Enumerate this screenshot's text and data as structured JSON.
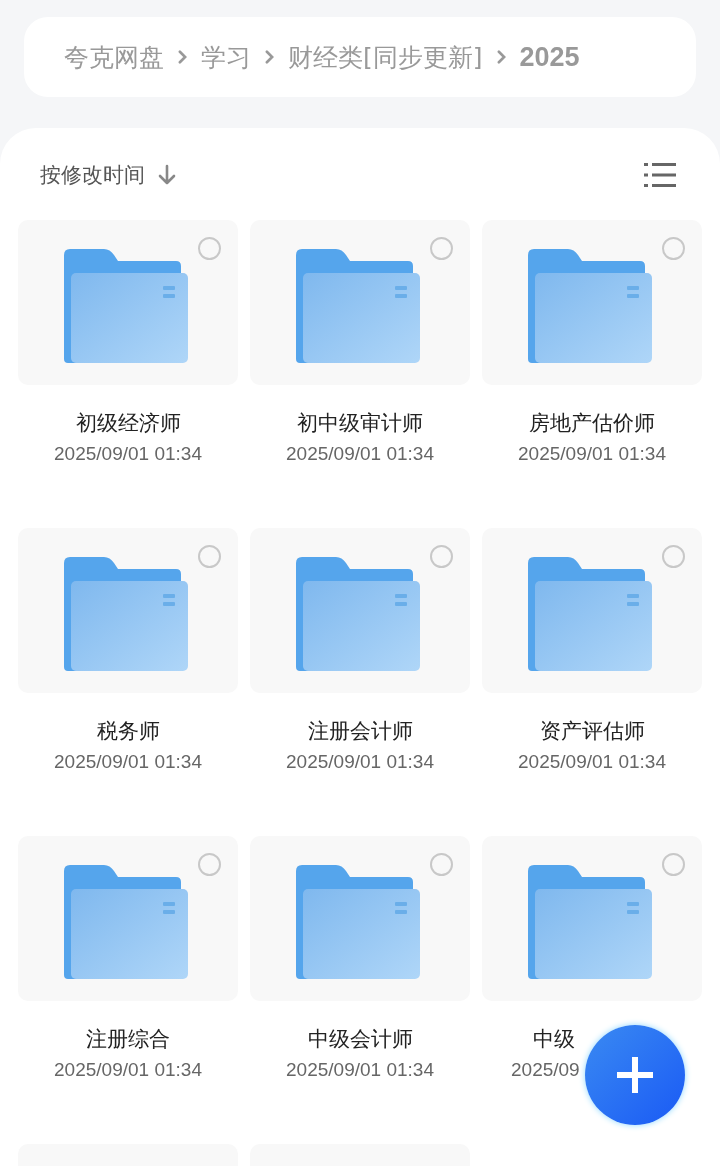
{
  "breadcrumb": [
    "夸克网盘",
    "学习",
    "财经类[同步更新]",
    "2025"
  ],
  "sort": {
    "label": "按修改时间"
  },
  "files": [
    {
      "kind": "folder",
      "name": "初级经济师",
      "date": "2025/09/01 01:34",
      "selected": false
    },
    {
      "kind": "folder",
      "name": "初中级审计师",
      "date": "2025/09/01 01:34",
      "selected": false
    },
    {
      "kind": "folder",
      "name": "房地产估价师",
      "date": "2025/09/01 01:34",
      "selected": false
    },
    {
      "kind": "folder",
      "name": "税务师",
      "date": "2025/09/01 01:34",
      "selected": false
    },
    {
      "kind": "folder",
      "name": "注册会计师",
      "date": "2025/09/01 01:34",
      "selected": false
    },
    {
      "kind": "folder",
      "name": "资产评估师",
      "date": "2025/09/01 01:34",
      "selected": false
    },
    {
      "kind": "folder",
      "name": "注册综合",
      "date": "2025/09/01 01:34",
      "selected": false
    },
    {
      "kind": "folder",
      "name": "中级会计师",
      "date": "2025/09/01 01:34",
      "selected": false
    },
    {
      "kind": "folder",
      "name": "中级",
      "date": "2025/09",
      "selected": false,
      "clipped": true
    },
    {
      "kind": "cut_off"
    },
    {
      "kind": "cut_off"
    }
  ]
}
